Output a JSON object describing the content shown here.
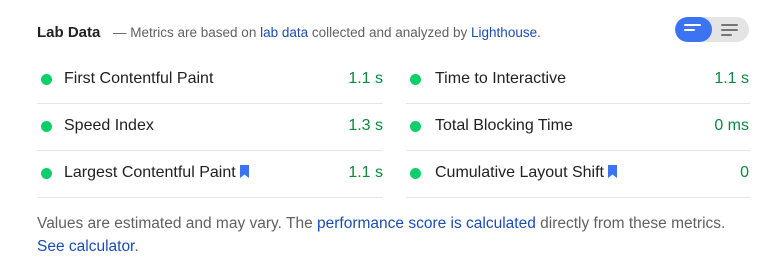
{
  "header": {
    "title": "Lab Data",
    "dash": "—",
    "subtitle_pre": "Metrics are based on",
    "subtitle_link1": "lab data",
    "subtitle_mid": "collected and analyzed by",
    "subtitle_link2": "Lighthouse",
    "subtitle_end": "."
  },
  "view_toggle": {
    "active_color": "#3b73f3",
    "inactive_color": "#e4e4e4"
  },
  "metrics_left": [
    {
      "label": "First Contentful Paint",
      "value": "1.1 s",
      "status": "pass",
      "bookmark": false
    },
    {
      "label": "Speed Index",
      "value": "1.3 s",
      "status": "pass",
      "bookmark": false
    },
    {
      "label": "Largest Contentful Paint",
      "value": "1.1 s",
      "status": "pass",
      "bookmark": true
    }
  ],
  "metrics_right": [
    {
      "label": "Time to Interactive",
      "value": "1.1 s",
      "status": "pass",
      "bookmark": false
    },
    {
      "label": "Total Blocking Time",
      "value": "0 ms",
      "status": "pass",
      "bookmark": false
    },
    {
      "label": "Cumulative Layout Shift",
      "value": "0",
      "status": "pass",
      "bookmark": true
    }
  ],
  "colors": {
    "pass_dot": "#0cce6b",
    "pass_value": "#0a8a3e",
    "link": "#1a4db3",
    "bookmark": "#3b73f3"
  },
  "footer": {
    "text_pre": "Values are estimated and may vary. The",
    "link1": "performance score is calculated",
    "text_mid": "directly from these metrics.",
    "link2": "See calculator",
    "text_end": "."
  }
}
